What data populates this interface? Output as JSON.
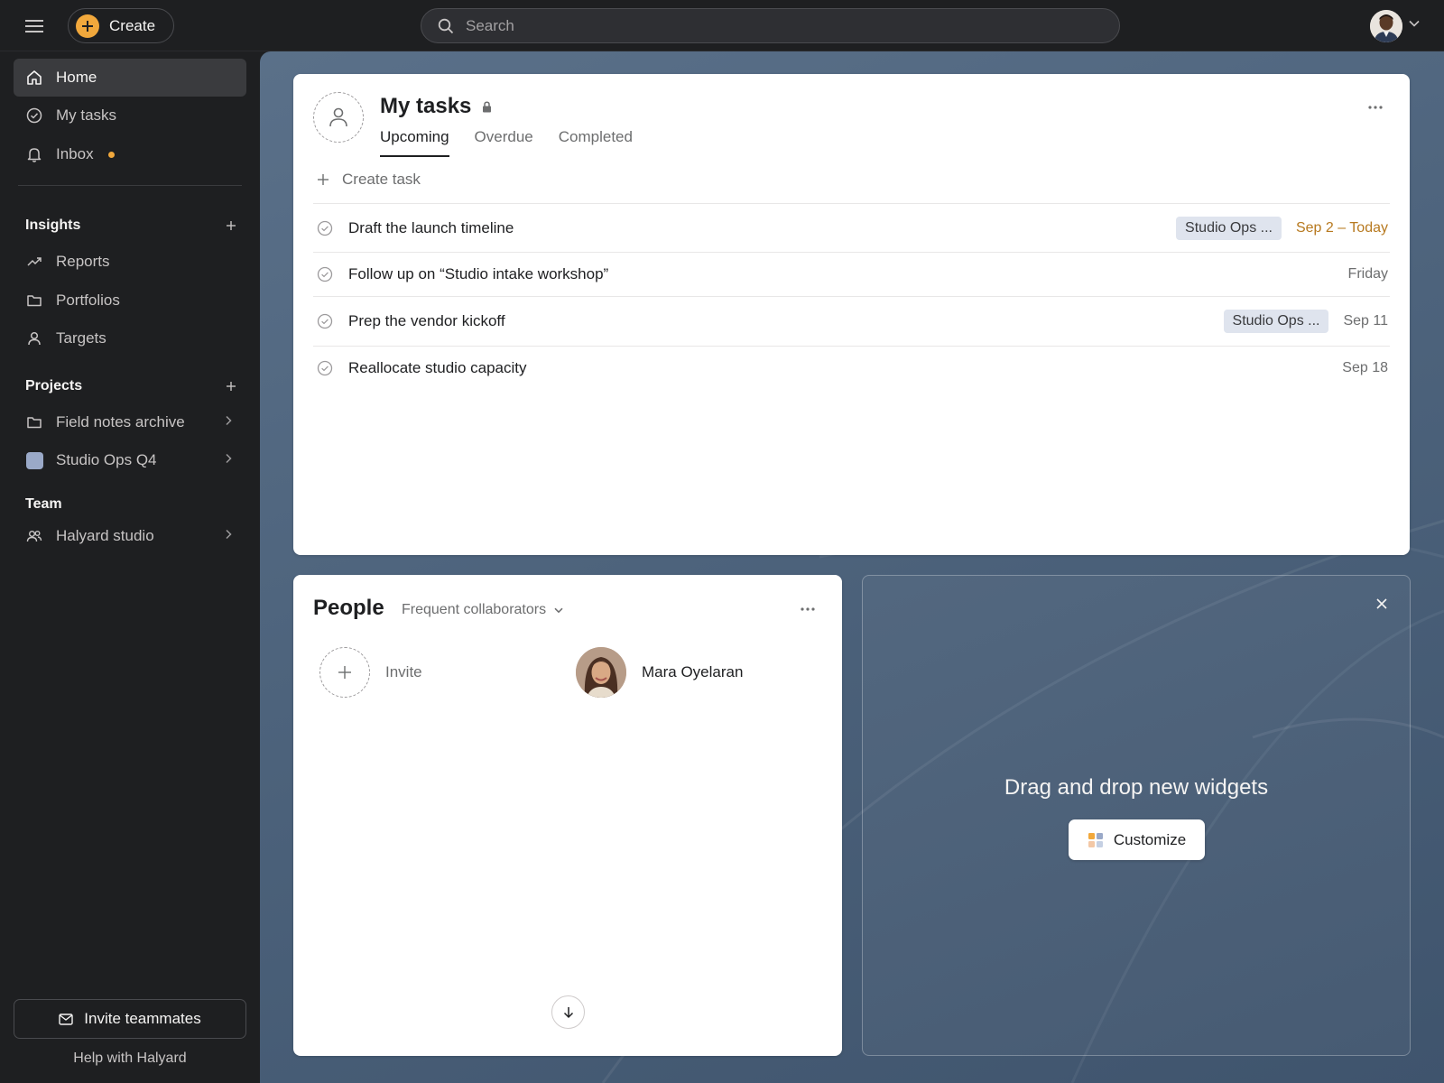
{
  "header": {
    "create_label": "Create",
    "search_placeholder": "Search",
    "icons": [
      "hamburger-icon",
      "plus-icon",
      "search-icon",
      "chevron-down-icon"
    ]
  },
  "sidebar": {
    "nav": [
      {
        "label": "Home",
        "icon": "home-icon",
        "active": true
      },
      {
        "label": "My tasks",
        "icon": "check-circle-icon"
      },
      {
        "label": "Inbox",
        "icon": "bell-icon",
        "has_notification": true
      }
    ],
    "insights": {
      "title": "Insights",
      "items": [
        {
          "label": "Reports",
          "icon": "trend-line-icon"
        },
        {
          "label": "Portfolios",
          "icon": "folder-icon"
        },
        {
          "label": "Targets",
          "icon": "person-icon"
        }
      ]
    },
    "projects": {
      "title": "Projects",
      "items": [
        {
          "label": "Field notes archive",
          "icon": "folder-icon"
        },
        {
          "label": "Studio Ops Q4",
          "icon": "project-swatch",
          "color": "#9aa9c8"
        }
      ]
    },
    "team": {
      "title": "Team",
      "items": [
        {
          "label": "Halyard studio",
          "icon": "people-icon"
        }
      ]
    },
    "invite_label": "Invite teammates",
    "help_label": "Help with Halyard"
  },
  "tasks_widget": {
    "title": "My tasks",
    "tabs": [
      "Upcoming",
      "Overdue",
      "Completed"
    ],
    "active_tab": "Upcoming",
    "create_label": "Create task",
    "tasks": [
      {
        "name": "Draft the launch timeline",
        "project": "Studio Ops ...",
        "due": "Sep 2 – Today",
        "due_today": true
      },
      {
        "name": "Follow up on “Studio intake workshop”",
        "project": "",
        "due": "Friday"
      },
      {
        "name": "Prep the vendor kickoff",
        "project": "Studio Ops ...",
        "due": "Sep 11"
      },
      {
        "name": "Reallocate studio capacity",
        "project": "",
        "due": "Sep 18"
      }
    ]
  },
  "people_widget": {
    "title": "People",
    "filter_label": "Frequent collaborators",
    "invite_label": "Invite",
    "people": [
      {
        "name": "Mara Oyelaran"
      }
    ]
  },
  "customize_widget": {
    "text": "Drag and drop new widgets",
    "button_label": "Customize"
  },
  "colors": {
    "accent_orange": "#f1a83c",
    "due_today": "#b7791f",
    "sidebar_bg": "#1e1f21",
    "tag_bg": "#dfe4ee"
  }
}
